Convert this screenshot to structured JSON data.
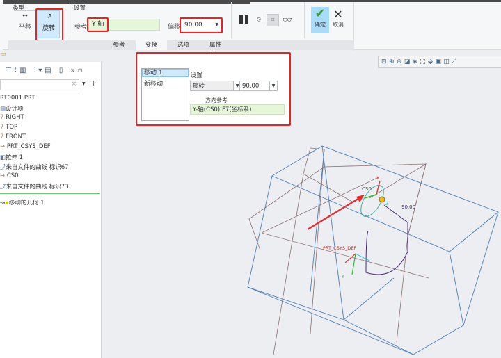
{
  "ribbon": {
    "type_label": "类型",
    "translate_label": "平移",
    "rotate_label": "旋转",
    "settings_label": "设置",
    "reference_label": "参考:",
    "reference_value": "Y 轴",
    "offset_label": "偏移",
    "offset_value": "90.00",
    "ok_label": "确定",
    "cancel_label": "取消"
  },
  "tabs": [
    "参考",
    "变换",
    "选项",
    "属性"
  ],
  "tree": {
    "items": [
      "RT0001.PRT",
      "设计项",
      "RIGHT",
      "TOP",
      "FRONT",
      "PRT_CSYS_DEF",
      "拉伸 1",
      "来自文件的曲线 标识67",
      "CS0",
      "来自文件的曲线 标识73",
      "移动的几何 1"
    ]
  },
  "transform_panel": {
    "moves": [
      "移动 1",
      "新移动"
    ],
    "settings_label": "设置",
    "mode_value": "旋转",
    "angle_value": "90.00",
    "direction_ref_label": "方向参考",
    "direction_ref_value": "Y-轴(CS0):F7(坐标系)"
  },
  "viewport": {
    "cs0_label": "CS0",
    "angle_label": "90.00",
    "prt_csys_label": "PRT_CSYS_DEF",
    "axis_x": "X",
    "axis_z": "Z",
    "axis_y": "Y"
  },
  "colors": {
    "highlight": "#f02020",
    "accent": "#cfeafc",
    "cube": "#4a7fb8",
    "plane": "#8a6f6f"
  }
}
